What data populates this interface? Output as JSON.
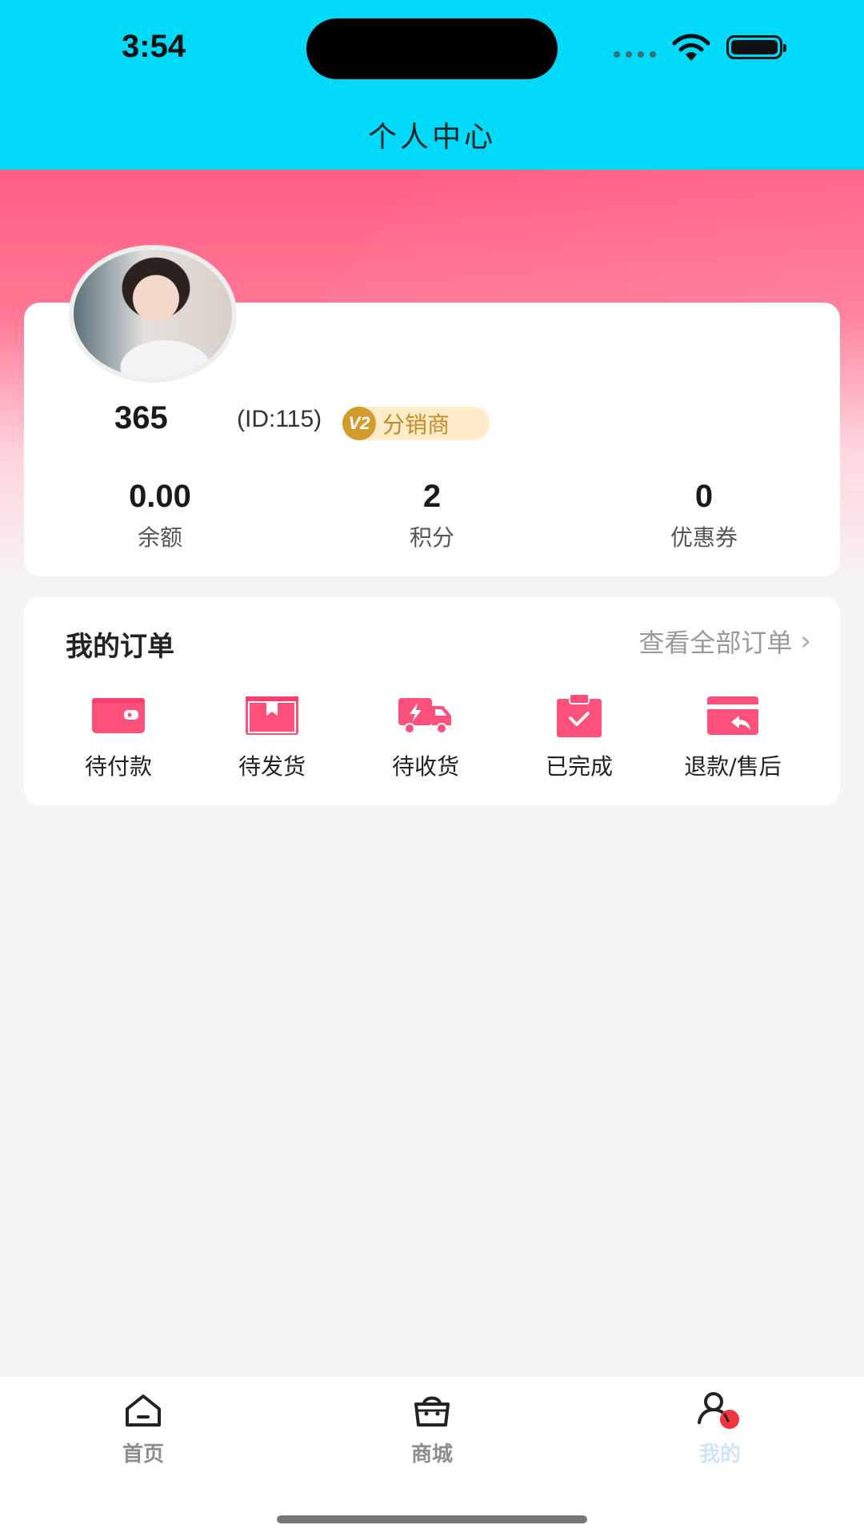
{
  "status_bar": {
    "time": "3:54"
  },
  "header": {
    "title": "个人中心"
  },
  "profile": {
    "name": "365",
    "id_text": "(ID:115)",
    "badge_icon": "V2",
    "badge_label": "分销商"
  },
  "stats": [
    {
      "value": "0.00",
      "label": "余额"
    },
    {
      "value": "2",
      "label": "积分"
    },
    {
      "value": "0",
      "label": "优惠券"
    }
  ],
  "orders": {
    "title": "我的订单",
    "view_all": "查看全部订单",
    "items": [
      {
        "label": "待付款",
        "icon": "wallet-icon"
      },
      {
        "label": "待发货",
        "icon": "box-icon"
      },
      {
        "label": "待收货",
        "icon": "truck-icon"
      },
      {
        "label": "已完成",
        "icon": "clipboard-check-icon"
      },
      {
        "label": "退款/售后",
        "icon": "refund-card-icon"
      }
    ]
  },
  "tabbar": {
    "items": [
      {
        "label": "首页",
        "icon": "home-icon"
      },
      {
        "label": "商城",
        "icon": "shop-bag-icon"
      },
      {
        "label": "我的",
        "icon": "user-icon",
        "active": true
      }
    ]
  },
  "colors": {
    "header": "#00daf8",
    "accent": "#ff4f7b",
    "badge_bg": "#fdecc7",
    "badge_text": "#c28a2a"
  }
}
